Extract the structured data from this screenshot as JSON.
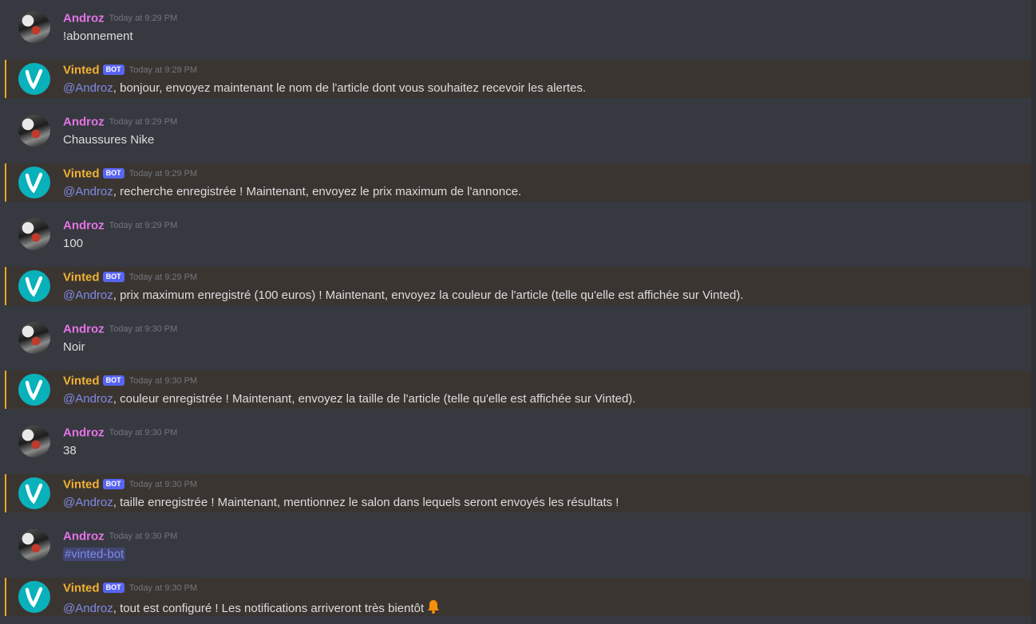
{
  "user_name": "Androz",
  "bot_name": "Vinted",
  "bot_badge": "BOT",
  "colors": {
    "background": "#36393f",
    "mention_bg": "#3b3532",
    "mention_bar": "#faa61a",
    "user_name": "#e473e6",
    "bot_name": "#f0b232",
    "link": "#7e8ae6",
    "bot_avatar": "#09b1ba"
  },
  "messages": [
    {
      "time": "Today at 9:29 PM",
      "text": "!abonnement"
    },
    {
      "time": "Today at 9:29 PM",
      "mention": "@Androz",
      "text": ", bonjour, envoyez maintenant le nom de l'article dont vous souhaitez recevoir les alertes."
    },
    {
      "time": "Today at 9:29 PM",
      "text": "Chaussures Nike"
    },
    {
      "time": "Today at 9:29 PM",
      "mention": "@Androz",
      "text": ", recherche enregistrée ! Maintenant, envoyez le prix maximum de l'annonce."
    },
    {
      "time": "Today at 9:29 PM",
      "text": "100"
    },
    {
      "time": "Today at 9:29 PM",
      "mention": "@Androz",
      "text": ", prix maximum enregistré (100 euros) ! Maintenant, envoyez la couleur de l'article (telle qu'elle est affichée sur Vinted)."
    },
    {
      "time": "Today at 9:30 PM",
      "text": "Noir"
    },
    {
      "time": "Today at 9:30 PM",
      "mention": "@Androz",
      "text": ", couleur enregistrée ! Maintenant, envoyez la taille de l'article (telle qu'elle est affichée sur Vinted)."
    },
    {
      "time": "Today at 9:30 PM",
      "text": "38"
    },
    {
      "time": "Today at 9:30 PM",
      "mention": "@Androz",
      "text": ", taille enregistrée ! Maintenant, mentionnez le salon dans lequels seront envoyés les résultats !"
    },
    {
      "time": "Today at 9:30 PM",
      "channel": "#vinted-bot"
    },
    {
      "time": "Today at 9:30 PM",
      "mention": "@Androz",
      "text": ", tout est configuré ! Les notifications arriveront très bientôt",
      "icon": "bell-icon"
    }
  ]
}
